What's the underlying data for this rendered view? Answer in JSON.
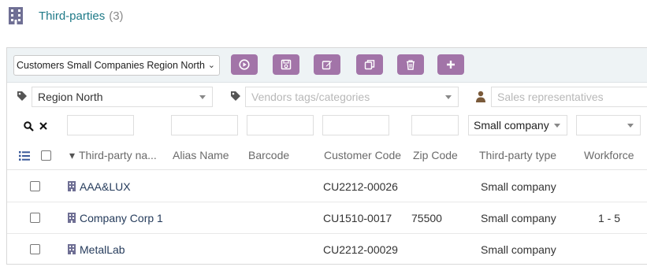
{
  "page": {
    "title": "Third-parties",
    "count": "(3)"
  },
  "toolbar": {
    "view_select": "Customers Small Companies Region North",
    "buttons": [
      {
        "name": "run-search-button",
        "icon": "play-circle-icon"
      },
      {
        "name": "save-view-button",
        "icon": "save-icon"
      },
      {
        "name": "edit-view-button",
        "icon": "edit-icon"
      },
      {
        "name": "clone-view-button",
        "icon": "copy-icon"
      },
      {
        "name": "delete-view-button",
        "icon": "trash-icon"
      },
      {
        "name": "add-view-button",
        "icon": "plus-icon"
      }
    ],
    "accent_color": "#a274a8"
  },
  "filters": {
    "customer_tags": "Region North",
    "vendor_tags_placeholder": "Vendors tags/categories",
    "sales_reps_placeholder": "Sales representatives"
  },
  "search": {
    "thirdparty_type": "Small company"
  },
  "columns": [
    "Third-party na...",
    "Alias Name",
    "Barcode",
    "Customer Code",
    "Zip Code",
    "Third-party type",
    "Workforce"
  ],
  "rows": [
    {
      "name": "AAA&LUX",
      "alias": "",
      "barcode": "",
      "code": "CU2212-00026",
      "zip": "",
      "type": "Small company",
      "workforce": ""
    },
    {
      "name": "Company Corp 1",
      "alias": "",
      "barcode": "",
      "code": "CU1510-0017",
      "zip": "75500",
      "type": "Small company",
      "workforce": "1 - 5"
    },
    {
      "name": "MetalLab",
      "alias": "",
      "barcode": "",
      "code": "CU2212-00029",
      "zip": "",
      "type": "Small company",
      "workforce": ""
    }
  ]
}
